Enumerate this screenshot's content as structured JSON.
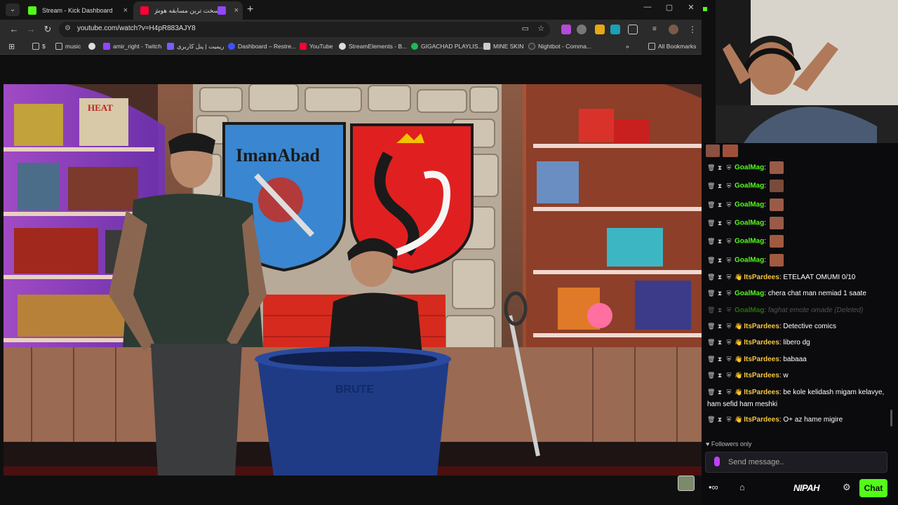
{
  "browser": {
    "tabs": [
      {
        "label": "Stream - Kick Dashboard",
        "close": "×"
      },
      {
        "label": "سخت ترین مسابقه هوش با ...",
        "close": "×"
      }
    ],
    "new_tab": "+",
    "window_controls": {
      "minimize": "—",
      "maximize": "▢",
      "close": "✕"
    },
    "url": "youtube.com/watch?v=H4pR883AJY8",
    "bookmarks": [
      {
        "label": "$"
      },
      {
        "label": "music"
      },
      {
        "label": ""
      },
      {
        "label": "amir_right - Twitch"
      },
      {
        "label": "ریمیت | پنل کاربری"
      },
      {
        "label": "Dashboard – Restre..."
      },
      {
        "label": "YouTube"
      },
      {
        "label": "StreamElements - B..."
      },
      {
        "label": "GIGACHAD PLAYLIS..."
      },
      {
        "label": "MINE SKIN"
      },
      {
        "label": "Nightbot - Comma..."
      },
      {
        "label": "»"
      },
      {
        "label": "All Bookmarks"
      }
    ]
  },
  "video": {
    "left_shield_text": "ImanAbad",
    "bin_text": "BRUTE",
    "box_text": "HEAT"
  },
  "chat": {
    "messages": [
      {
        "user": "GoalMag",
        "text": "",
        "emote": true,
        "deleted": false
      },
      {
        "user": "GoalMag",
        "text": "",
        "emote": true,
        "deleted": false
      },
      {
        "user": "GoalMag",
        "text": "",
        "emote": true,
        "deleted": false
      },
      {
        "user": "GoalMag",
        "text": "",
        "emote": true,
        "deleted": false
      },
      {
        "user": "GoalMag",
        "text": "",
        "emote": true,
        "deleted": false
      },
      {
        "user": "GoalMag",
        "text": "",
        "emote": true,
        "deleted": false
      },
      {
        "user": "ItsPardees",
        "text": "ETELAAT OMUMI 0/10",
        "emote": false,
        "deleted": false
      },
      {
        "user": "GoalMag",
        "text": "chera chat man nemiad 1 saate",
        "emote": false,
        "deleted": false
      },
      {
        "user": "GoalMag",
        "text": "faghat emote omade (Deleted)",
        "emote": false,
        "deleted": true
      },
      {
        "user": "ItsPardees",
        "text": "Detective comics",
        "emote": false,
        "deleted": false
      },
      {
        "user": "ItsPardees",
        "text": "libero dg",
        "emote": false,
        "deleted": false
      },
      {
        "user": "ItsPardees",
        "text": "babaaa",
        "emote": false,
        "deleted": false
      },
      {
        "user": "ItsPardees",
        "text": "w",
        "emote": false,
        "deleted": false
      },
      {
        "user": "ItsPardees",
        "text": "be kole kelidash migam kelavye, ham sefid ham meshki",
        "emote": false,
        "deleted": false
      },
      {
        "user": "ItsPardees",
        "text": "O+ az hame migire",
        "emote": false,
        "deleted": false
      }
    ],
    "followers_only": "Followers only",
    "send_placeholder": "Send message..",
    "brand": "NIPAH",
    "chat_button": "Chat"
  },
  "colors": {
    "kick_green": "#53fc18",
    "user_goalmag": "#53fc18",
    "user_itspardees": "#f4c542",
    "browser_bg": "#2b2b2b"
  }
}
